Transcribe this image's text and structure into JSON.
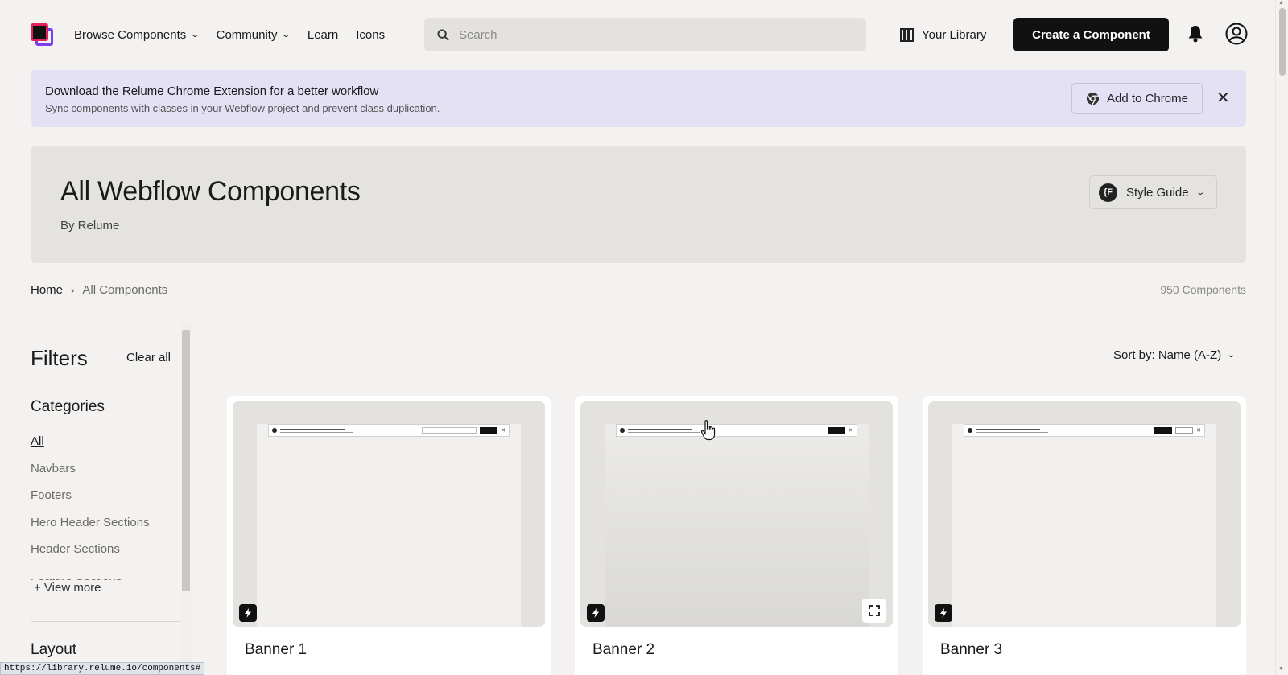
{
  "nav": {
    "browse_label": "Browse Components",
    "community_label": "Community",
    "learn_label": "Learn",
    "icons_label": "Icons",
    "search_placeholder": "Search",
    "library_label": "Your Library",
    "create_label": "Create a Component"
  },
  "extension_banner": {
    "title": "Download the Relume Chrome Extension for a better workflow",
    "subtitle": "Sync components with classes in your Webflow project and prevent class duplication.",
    "button_label": "Add to Chrome",
    "close_glyph": "✕"
  },
  "hero": {
    "title": "All Webflow Components",
    "byline": "By Relume",
    "style_guide_icon": "{F",
    "style_guide_label": "Style Guide"
  },
  "breadcrumb": {
    "home": "Home",
    "separator": "›",
    "current": "All Components"
  },
  "component_count": "950 Components",
  "filters": {
    "title": "Filters",
    "clear_label": "Clear all",
    "categories_title": "Categories",
    "categories": [
      {
        "label": "All",
        "active": true
      },
      {
        "label": "Navbars",
        "active": false
      },
      {
        "label": "Footers",
        "active": false
      },
      {
        "label": "Hero Header Sections",
        "active": false
      },
      {
        "label": "Header Sections",
        "active": false
      },
      {
        "label": "Feature Sections",
        "active": false
      }
    ],
    "view_more_label": "+  View more",
    "layout_title": "Layout"
  },
  "sort": {
    "label": "Sort by: Name (A-Z)"
  },
  "cards": [
    {
      "name": "Banner 1",
      "variant": "input-and-button"
    },
    {
      "name": "Banner 2",
      "variant": "single-button"
    },
    {
      "name": "Banner 3",
      "variant": "two-buttons"
    }
  ],
  "status_url": "https://library.relume.io/components#",
  "colors": {
    "accent_pink": "#e2225d",
    "accent_purple": "#7b3ff2",
    "banner_bg": "#e4e1f5",
    "primary_button": "#111111"
  },
  "icons": {
    "search": "search-icon",
    "library": "library-icon",
    "bell": "bell-icon",
    "user": "user-icon",
    "chrome": "chrome-icon",
    "bolt": "bolt-icon",
    "expand": "expand-icon"
  }
}
